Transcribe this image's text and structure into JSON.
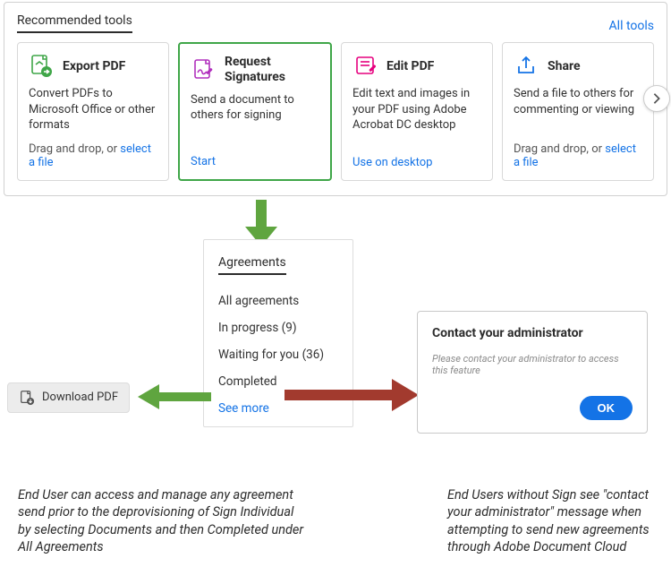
{
  "header": {
    "section_title": "Recommended tools",
    "all_tools": "All tools"
  },
  "cards": {
    "export": {
      "title": "Export PDF",
      "desc": "Convert PDFs to Microsoft Office or other formats",
      "footer_prefix": "Drag and drop, or ",
      "footer_link": "select a file"
    },
    "request": {
      "title": "Request Signatures",
      "desc": "Send a document to others for signing",
      "action": "Start"
    },
    "edit": {
      "title": "Edit PDF",
      "desc": "Edit text and images in your PDF using Adobe Acrobat DC desktop",
      "action": "Use on desktop"
    },
    "share": {
      "title": "Share",
      "desc": "Send a file to others for commenting or viewing",
      "footer_prefix": "Drag and drop, or ",
      "footer_link": "select a file"
    }
  },
  "download_button": "Download PDF",
  "agreements": {
    "title": "Agreements",
    "all": "All agreements",
    "in_progress": "In progress (9)",
    "waiting": "Waiting for you (36)",
    "completed": "Completed",
    "see_more": "See more"
  },
  "dialog": {
    "title": "Contact your administrator",
    "message": "Please contact your administrator to access this feature",
    "ok": "OK"
  },
  "captions": {
    "left": "End User can access and manage any agreement send prior to the deprovisioning of Sign Individual by selecting Documents and then Completed under All Agreements",
    "right": "End Users without Sign see \"contact your administrator\" message when attempting to send new agreements through Adobe Document Cloud"
  },
  "colors": {
    "link": "#1473e6",
    "highlight_border": "#3fa648",
    "arrow_green": "#5fa53f",
    "arrow_red": "#a23a2e"
  }
}
